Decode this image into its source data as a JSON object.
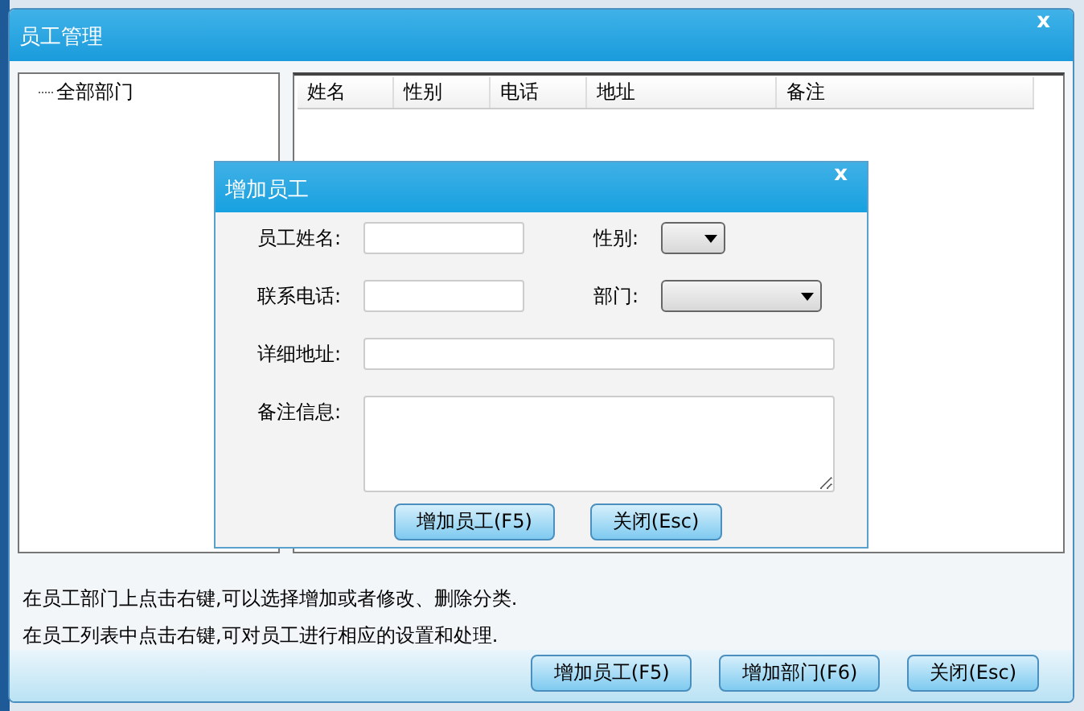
{
  "window": {
    "title": "员工管理",
    "close": "x"
  },
  "tree": {
    "items": [
      {
        "label": "全部部门"
      }
    ]
  },
  "table": {
    "columns": [
      "姓名",
      "性别",
      "电话",
      "地址",
      "备注"
    ]
  },
  "help_texts": [
    "在员工部门上点击右键,可以选择增加或者修改、删除分类.",
    "在员工列表中点击右键,可对员工进行相应的设置和处理."
  ],
  "buttons": [
    "增加员工(F5)",
    "增加部门(F6)",
    "关闭(Esc)"
  ],
  "dialog": {
    "title": "增加员工",
    "close": "x",
    "fields": [
      {
        "label": "员工姓名:",
        "kind": "text"
      },
      {
        "label": "性别:",
        "kind": "select"
      },
      {
        "label": "联系电话:",
        "kind": "text"
      },
      {
        "label": "部门:",
        "kind": "select"
      },
      {
        "label": "详细地址:",
        "kind": "wide"
      },
      {
        "label": "备注信息:",
        "kind": "textarea"
      }
    ],
    "buttons": [
      "增加员工(F5)",
      "关闭(Esc)"
    ]
  }
}
